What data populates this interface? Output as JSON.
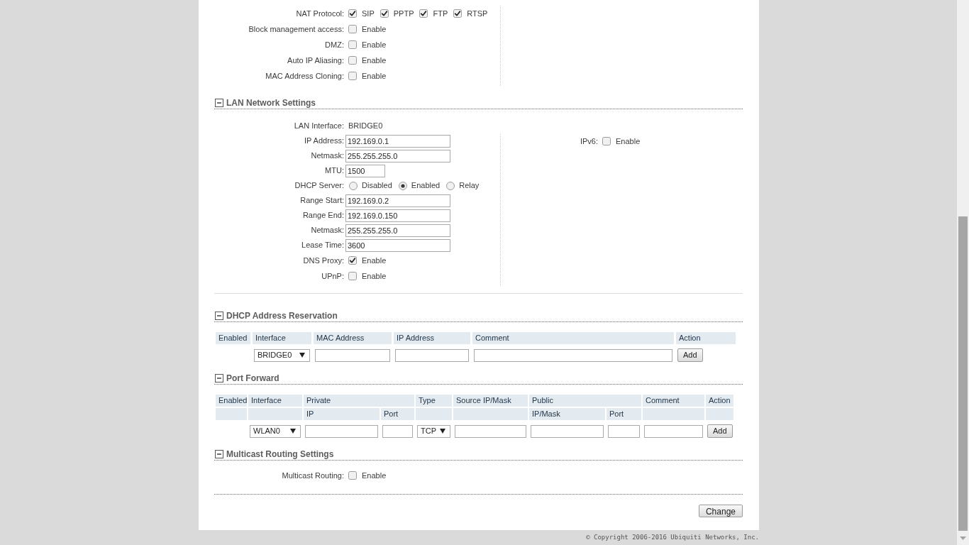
{
  "sections": [
    {
      "kind": "form",
      "left": [
        {
          "kind": "checks",
          "label": "NAT Protocol:",
          "options": [
            {
              "label": "SIP",
              "checked": true
            },
            {
              "label": "PPTP",
              "checked": true
            },
            {
              "label": "FTP",
              "checked": true
            },
            {
              "label": "RTSP",
              "checked": true
            }
          ]
        },
        {
          "kind": "checks",
          "label": "Block management access:",
          "options": [
            {
              "label": "Enable",
              "checked": false
            }
          ]
        },
        {
          "kind": "checks",
          "label": "DMZ:",
          "options": [
            {
              "label": "Enable",
              "checked": false
            }
          ]
        },
        {
          "kind": "checks",
          "label": "Auto IP Aliasing:",
          "options": [
            {
              "label": "Enable",
              "checked": false
            }
          ]
        },
        {
          "kind": "checks",
          "label": "MAC Address Cloning:",
          "options": [
            {
              "label": "Enable",
              "checked": false
            }
          ]
        }
      ]
    },
    {
      "kind": "form",
      "title": "LAN Network Settings",
      "expanded": true,
      "lead": [
        {
          "kind": "text",
          "label": "LAN Interface:",
          "value": "BRIDGE0"
        }
      ],
      "left": [
        {
          "kind": "field",
          "label": "IP Address:",
          "value": "192.169.0.1"
        },
        {
          "kind": "field",
          "label": "Netmask:",
          "value": "255.255.255.0"
        },
        {
          "kind": "smallfield",
          "label": "MTU:",
          "value": "1500"
        },
        {
          "kind": "radios",
          "label": "DHCP Server:",
          "options": [
            {
              "label": "Disabled",
              "selected": false
            },
            {
              "label": "Enabled",
              "selected": true
            },
            {
              "label": "Relay",
              "selected": false
            }
          ]
        },
        {
          "kind": "field",
          "label": "Range Start:",
          "value": "192.169.0.2"
        },
        {
          "kind": "field",
          "label": "Range End:",
          "value": "192.169.0.150"
        },
        {
          "kind": "field",
          "label": "Netmask:",
          "value": "255.255.255.0"
        },
        {
          "kind": "field",
          "label": "Lease Time:",
          "value": "3600"
        },
        {
          "kind": "checks",
          "label": "DNS Proxy:",
          "options": [
            {
              "label": "Enable",
              "checked": true
            }
          ]
        },
        {
          "kind": "checks",
          "label": "UPnP:",
          "options": [
            {
              "label": "Enable",
              "checked": false
            }
          ]
        }
      ],
      "right": [
        {
          "kind": "checks",
          "label": "IPv6:",
          "options": [
            {
              "label": "Enable",
              "checked": false
            }
          ]
        }
      ]
    },
    {
      "kind": "table",
      "title": "DHCP Address Reservation",
      "expanded": true,
      "columns": [
        {
          "label": "Enabled"
        },
        {
          "label": "Interface"
        },
        {
          "label": "MAC Address"
        },
        {
          "label": "IP Address"
        },
        {
          "label": "Comment"
        },
        {
          "label": "Action"
        }
      ],
      "input_row": [
        {
          "kind": "empty"
        },
        {
          "kind": "select",
          "value": "BRIDGE0"
        },
        {
          "kind": "input"
        },
        {
          "kind": "input"
        },
        {
          "kind": "input"
        },
        {
          "kind": "button",
          "label": "Add"
        }
      ]
    },
    {
      "kind": "table",
      "title": "Port Forward",
      "expanded": true,
      "columns": [
        {
          "label": "Enabled"
        },
        {
          "label": "Interface"
        },
        {
          "label": "Private",
          "sub": [
            "IP",
            "Port"
          ]
        },
        {
          "label": "Type"
        },
        {
          "label": "Source IP/Mask"
        },
        {
          "label": "Public",
          "sub": [
            "IP/Mask",
            "Port"
          ]
        },
        {
          "label": "Comment"
        },
        {
          "label": "Action"
        }
      ],
      "input_row": [
        {
          "kind": "empty"
        },
        {
          "kind": "select",
          "value": "WLAN0"
        },
        {
          "kind": "input"
        },
        {
          "kind": "input"
        },
        {
          "kind": "select",
          "value": "TCP"
        },
        {
          "kind": "input"
        },
        {
          "kind": "input"
        },
        {
          "kind": "input"
        },
        {
          "kind": "input"
        },
        {
          "kind": "button",
          "label": "Add"
        }
      ]
    },
    {
      "kind": "form",
      "title": "Multicast Routing Settings",
      "expanded": true,
      "rows": [
        {
          "kind": "checks",
          "label": "Multicast Routing:",
          "options": [
            {
              "label": "Enable",
              "checked": false
            }
          ]
        }
      ]
    }
  ],
  "change_button": "Change",
  "footer": {
    "copyright": "© Copyright 2006-2016 Ubiquiti Networks, Inc."
  }
}
